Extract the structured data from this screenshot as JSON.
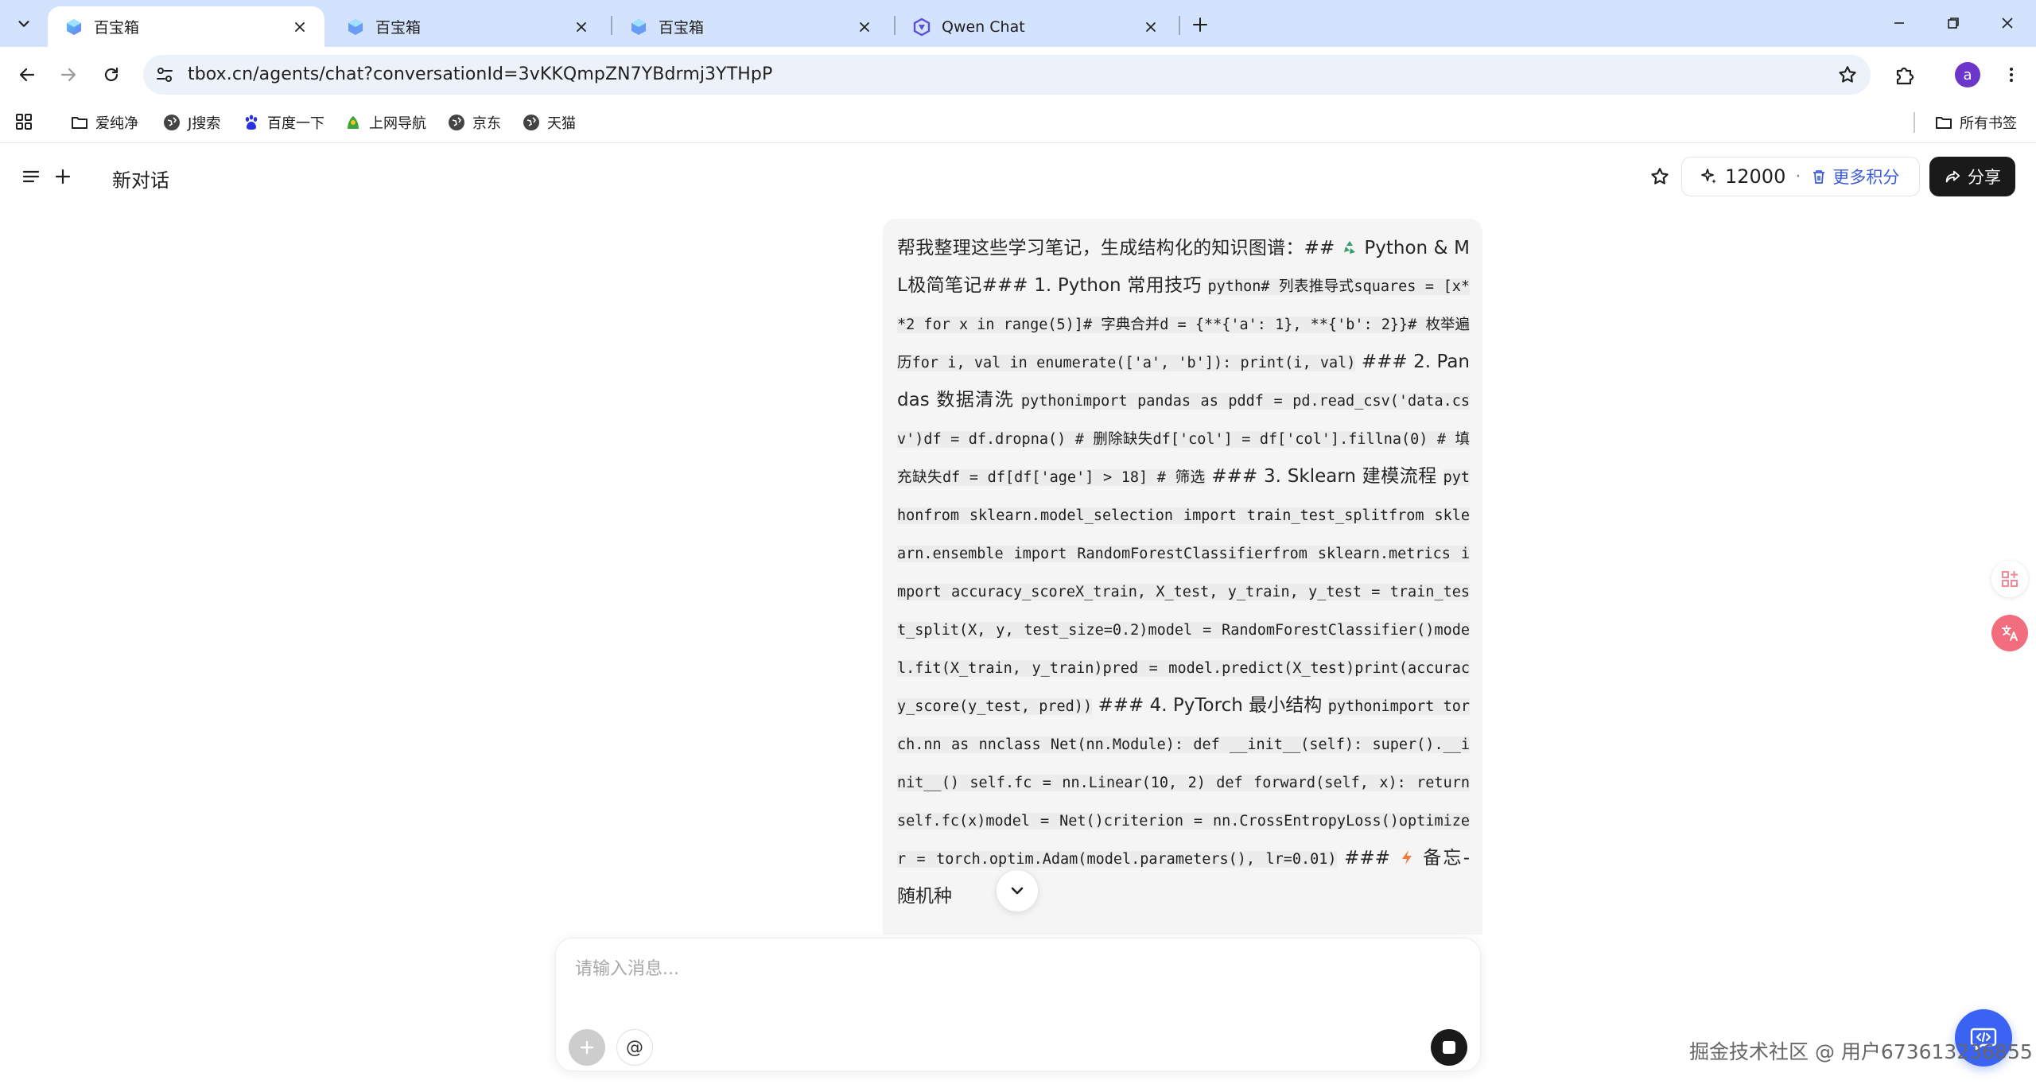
{
  "browser": {
    "tabs": [
      {
        "title": "百宝箱",
        "active": true
      },
      {
        "title": "百宝箱",
        "active": false
      },
      {
        "title": "百宝箱",
        "active": false
      },
      {
        "title": "Qwen Chat",
        "active": false
      }
    ],
    "url": "tbox.cn/agents/chat?conversationId=3vKKQmpZN7YBdrmj3YTHpP",
    "profile_initial": "a",
    "bookmarks": [
      {
        "label": "爱纯净",
        "icon": "folder-icon"
      },
      {
        "label": "J搜索",
        "icon": "globe-icon"
      },
      {
        "label": "百度一下",
        "icon": "baidu-paw-icon"
      },
      {
        "label": "上网导航",
        "icon": "navigation-site-icon"
      },
      {
        "label": "京东",
        "icon": "globe-icon"
      },
      {
        "label": "天猫",
        "icon": "globe-icon"
      }
    ],
    "all_bookmarks": "所有书签"
  },
  "header": {
    "title": "新对话",
    "credits": "12000",
    "separator": "·",
    "more_credits": "更多积分",
    "share": "分享"
  },
  "message": {
    "segments": [
      {
        "t": "帮我整理这些学习笔记，生成结构化的知识图谱：## "
      },
      {
        "t": "",
        "emoji": "recycle-emoji"
      },
      {
        "t": " Python & ML极简笔记### 1. Python 常用技巧 "
      },
      {
        "t": "python# 列表推导式squares = [x**2 for x in range(5)]# 字典合并d = {**{'a': 1}, **{'b': 2}}# 枚举遍历for i, val in enumerate(['a', 'b']):    print(i, val)",
        "code": true
      },
      {
        "t": " ### 2. Pandas 数据清洗 "
      },
      {
        "t": "pythonimport pandas as pddf = pd.read_csv('data.csv')df = df.dropna()                    # 删除缺失df['col'] = df['col'].fillna(0)   # 填充缺失df = df[df['age'] > 18]           # 筛选",
        "code": true
      },
      {
        "t": " ### 3. Sklearn 建模流程 "
      },
      {
        "t": "pythonfrom sklearn.model_selection import train_test_splitfrom sklearn.ensemble import RandomForestClassifierfrom sklearn.metrics import accuracy_scoreX_train, X_test, y_train, y_test = train_test_split(X, y, test_size=0.2)model = RandomForestClassifier()model.fit(X_train, y_train)pred = model.predict(X_test)print(accuracy_score(y_test, pred))",
        "code": true
      },
      {
        "t": " ### 4. PyTorch 最小结构 "
      },
      {
        "t": "pythonimport torch.nn as nnclass Net(nn.Module):    def __init__(self):        super().__init__()        self.fc = nn.Linear(10, 2)    def forward(self, x):        return self.fc(x)model = Net()criterion = nn.CrossEntropyLoss()optimizer = torch.optim.Adam(model.parameters(), lr=0.01)",
        "code": true
      },
      {
        "t": " ### "
      },
      {
        "t": "",
        "emoji": "lightning-emoji"
      },
      {
        "t": " 备忘- 随机种"
      }
    ]
  },
  "composer": {
    "placeholder": "请输入消息...",
    "mention": "@"
  },
  "watermark": "掘金技术社区 @ 用户67361323685​5"
}
